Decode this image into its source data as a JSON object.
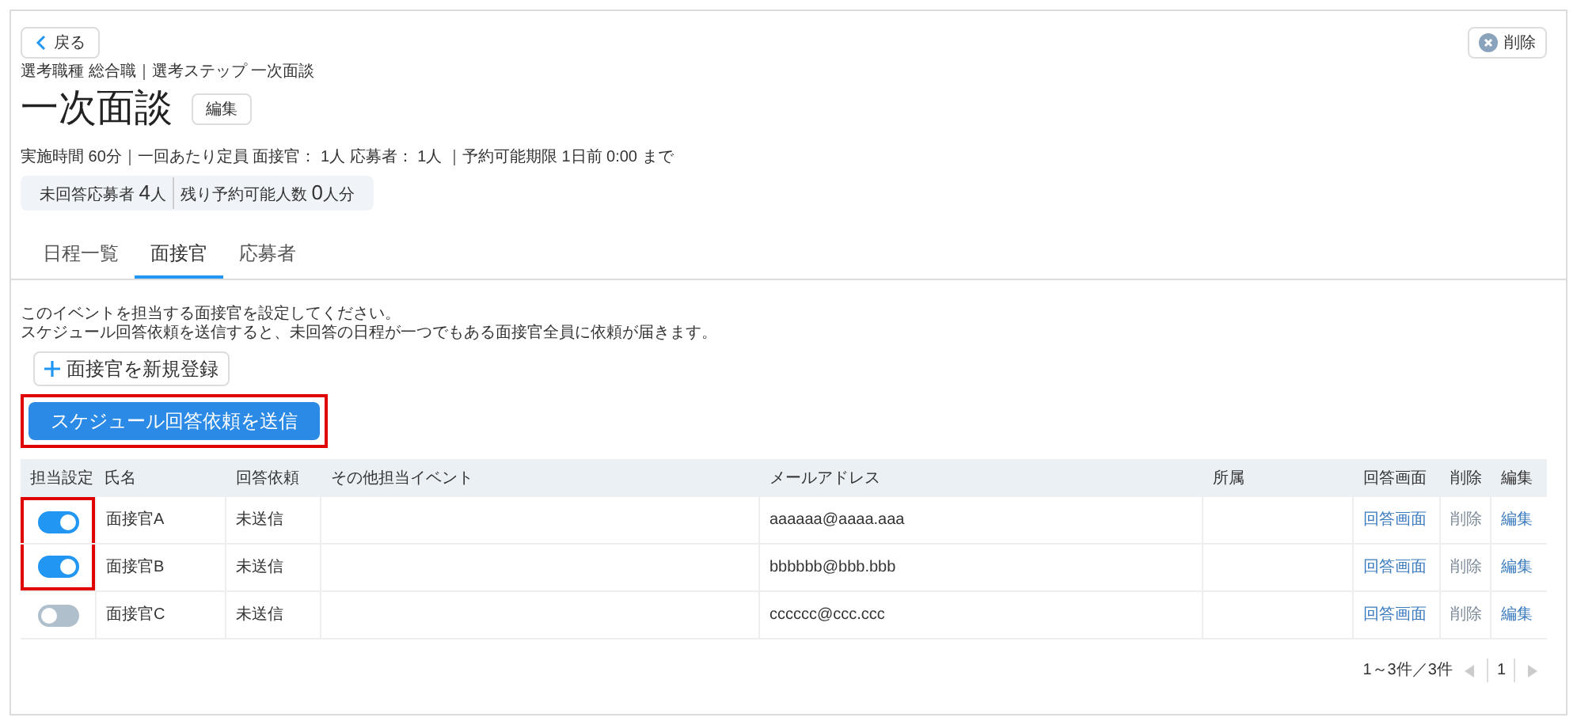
{
  "back_button": "戻る",
  "delete_button": "削除",
  "breadcrumb": "選考職種 総合職｜選考ステップ 一次面談",
  "title": "一次面談",
  "edit_button": "編集",
  "meta": "実施時間 60分｜一回あたり定員 面接官： 1人 応募者： 1人 ｜予約可能期限 1日前 0:00 まで",
  "summary": [
    {
      "label": "未回答応募者",
      "value": "4",
      "unit": "人"
    },
    {
      "label": "残り予約可能人数",
      "value": "0",
      "unit": "人分"
    }
  ],
  "tabs": [
    {
      "label": "日程一覧",
      "selected": false
    },
    {
      "label": "面接官",
      "selected": true
    },
    {
      "label": "応募者",
      "selected": false
    }
  ],
  "instructions": [
    "このイベントを担当する面接官を設定してください。",
    "スケジュール回答依頼を送信すると、未回答の日程が一つでもある面接官全員に依頼が届きます。"
  ],
  "register_button": "面接官を新規登録",
  "send_button": {
    "label": "スケジュール回答依頼を送信",
    "highlighted": true
  },
  "table": {
    "columns": [
      "担当設定",
      "氏名",
      "回答依頼",
      "その他担当イベント",
      "メールアドレス",
      "所属",
      "回答画面",
      "削除",
      "編集"
    ],
    "rows": [
      {
        "on": true,
        "highlighted": true,
        "name": "面接官A",
        "request": "未送信",
        "email": "aaaaaa@aaaa.aaa",
        "answer": "回答画面",
        "delete": "削除",
        "edit": "編集"
      },
      {
        "on": true,
        "highlighted": true,
        "name": "面接官B",
        "request": "未送信",
        "email": "bbbbbb@bbb.bbb",
        "answer": "回答画面",
        "delete": "削除",
        "edit": "編集"
      },
      {
        "on": false,
        "highlighted": false,
        "name": "面接官C",
        "request": "未送信",
        "email": "cccccc@ccc.ccc",
        "answer": "回答画面",
        "delete": "削除",
        "edit": "編集"
      }
    ]
  },
  "pagination": {
    "range": "1～3件／3件",
    "page": "1"
  }
}
